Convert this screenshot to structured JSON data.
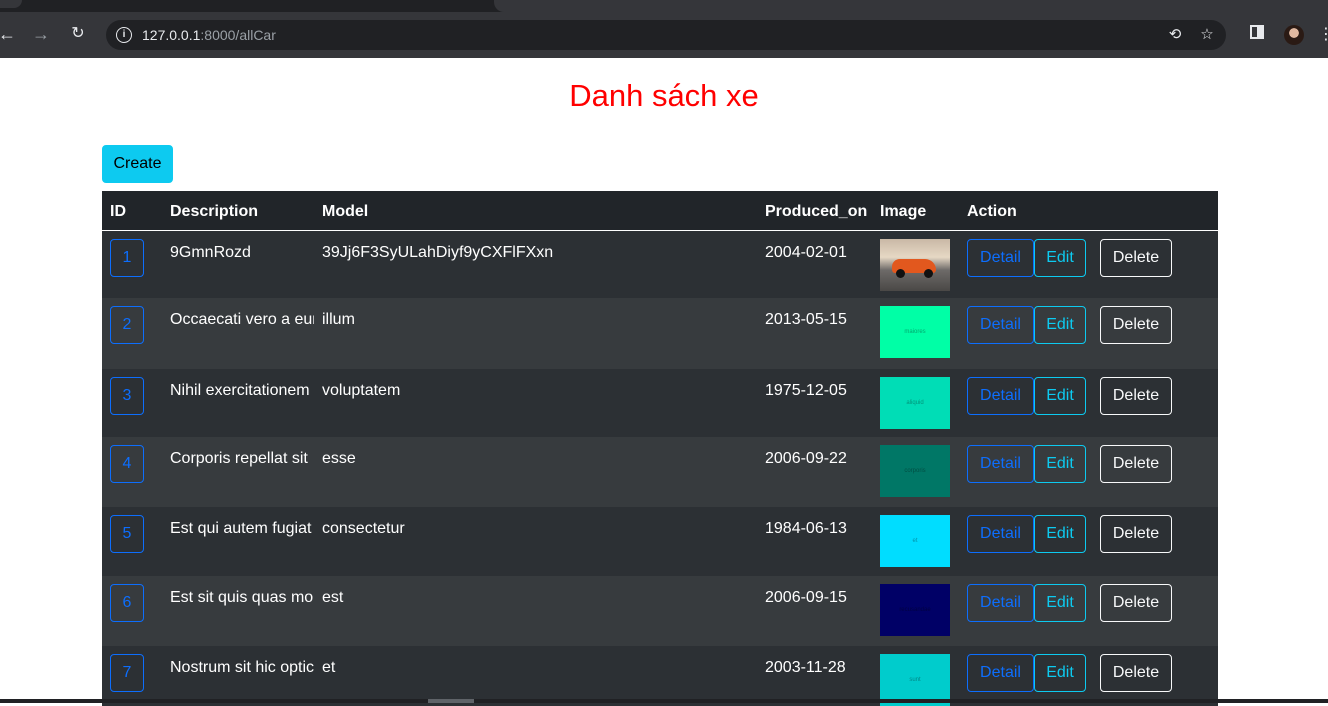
{
  "browser": {
    "url_host": "127.0.0.1",
    "url_path": ":8000/allCar"
  },
  "page": {
    "title": "Danh sách xe",
    "create_label": "Create"
  },
  "table": {
    "headers": [
      "ID",
      "Description",
      "Model",
      "Produced_on",
      "Image",
      "Action"
    ],
    "detail_label": "Detail",
    "edit_label": "Edit",
    "delete_label": "Delete",
    "rows": [
      {
        "id": "1",
        "description": "9GmnRozd",
        "model": "39Jj6F3SyULahDiyf9yCXFlFXxn",
        "produced_on": "2004-02-01",
        "image": "car-photo",
        "image_color": "#8a7a6a",
        "image_text": ""
      },
      {
        "id": "2",
        "description": "Occaecati vero a eur",
        "model": "illum",
        "produced_on": "2013-05-15",
        "image": "placeholder",
        "image_color": "#00ffa6",
        "image_text": "maiores"
      },
      {
        "id": "3",
        "description": "Nihil exercitationem",
        "model": "voluptatem",
        "produced_on": "1975-12-05",
        "image": "placeholder",
        "image_color": "#00ddb6",
        "image_text": "aliquid"
      },
      {
        "id": "4",
        "description": "Corporis repellat sit",
        "model": "esse",
        "produced_on": "2006-09-22",
        "image": "placeholder",
        "image_color": "#007766",
        "image_text": "corporis"
      },
      {
        "id": "5",
        "description": "Est qui autem fugiat",
        "model": "consectetur",
        "produced_on": "1984-06-13",
        "image": "placeholder",
        "image_color": "#00ddff",
        "image_text": "et"
      },
      {
        "id": "6",
        "description": "Est sit quis quas mol",
        "model": "est",
        "produced_on": "2006-09-15",
        "image": "placeholder",
        "image_color": "#000066",
        "image_text": "recusandae"
      },
      {
        "id": "7",
        "description": "Nostrum sit hic optic",
        "model": "et",
        "produced_on": "2003-11-28",
        "image": "placeholder",
        "image_color": "#00cccc",
        "image_text": "sunt"
      }
    ]
  }
}
